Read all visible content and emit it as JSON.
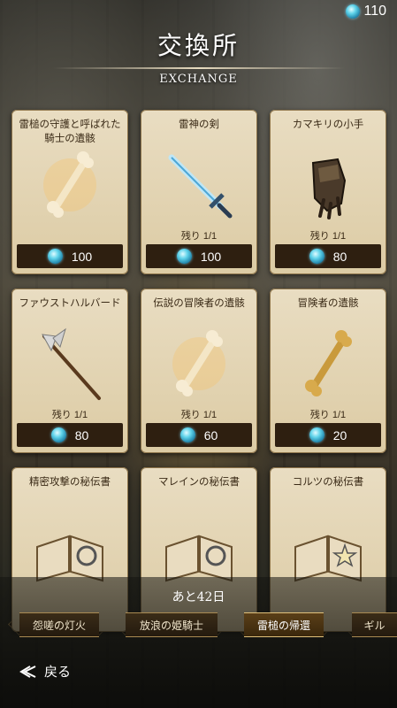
{
  "currency": {
    "amount": "110"
  },
  "header": {
    "title": "交換所",
    "subtitle": "EXCHANGE"
  },
  "items": [
    {
      "name": "雷槌の守護と呼ばれた騎士の遺骸",
      "remaining": "",
      "price": "100",
      "icon": "bone-icon"
    },
    {
      "name": "雷神の剣",
      "remaining": "残り 1/1",
      "price": "100",
      "icon": "sword-icon"
    },
    {
      "name": "カマキリの小手",
      "remaining": "残り 1/1",
      "price": "80",
      "icon": "gauntlet-icon"
    },
    {
      "name": "ファウストハルバード",
      "remaining": "残り 1/1",
      "price": "80",
      "icon": "halberd-icon"
    },
    {
      "name": "伝説の冒険者の遺骸",
      "remaining": "残り 1/1",
      "price": "60",
      "icon": "bone-icon"
    },
    {
      "name": "冒険者の遺骸",
      "remaining": "残り 1/1",
      "price": "20",
      "icon": "bone-icon"
    },
    {
      "name": "精密攻撃の秘伝書",
      "remaining": "",
      "price": "",
      "icon": "book-icon"
    },
    {
      "name": "マレインの秘伝書",
      "remaining": "",
      "price": "",
      "icon": "book-icon"
    },
    {
      "name": "コルツの秘伝書",
      "remaining": "",
      "price": "",
      "icon": "book-icon"
    }
  ],
  "footer": {
    "days_left": "あと42日",
    "tabs": [
      "怨嗟の灯火",
      "放浪の姫騎士",
      "雷槌の帰還",
      "ギル"
    ],
    "active_tab": 2,
    "back_label": "戻る"
  }
}
